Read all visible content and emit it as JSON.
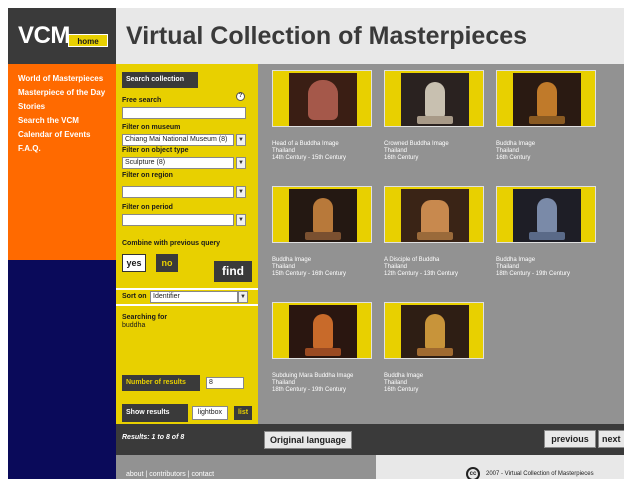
{
  "header": {
    "logo": "VCM",
    "home_label": "home",
    "title": "Virtual Collection of Masterpieces"
  },
  "nav": {
    "items": [
      {
        "label": "World of Masterpieces"
      },
      {
        "label": "Masterpiece of the Day"
      },
      {
        "label": "Stories"
      },
      {
        "label": "Search the VCM"
      },
      {
        "label": "Calendar of Events"
      },
      {
        "label": "F.A.Q."
      }
    ]
  },
  "search": {
    "tab_label": "Search collection",
    "free_search_label": "Free search",
    "free_search_value": "",
    "help_icon": "?",
    "museum_label": "Filter on museum",
    "museum_value": "Chiang Mai National Museum (8)",
    "object_type_label": "Filter on object type",
    "object_type_value": "Sculpture (8)",
    "region_label": "Filter on region",
    "region_value": "",
    "period_label": "Filter on period",
    "period_value": "",
    "combine_label": "Combine with previous query",
    "yes_label": "yes",
    "no_label": "no",
    "find_label": "find",
    "sort_label": "Sort on",
    "sort_value": "Identifier",
    "searching_for_label": "Searching for",
    "searching_for_value": "buddha",
    "num_results_label": "Number of results",
    "num_results_value": "8",
    "show_results_label": "Show results",
    "lightbox_label": "lightbox",
    "list_label": "list",
    "results_count": "Results: 1 to 8 of 8"
  },
  "results": [
    {
      "name": "Head of a Buddha Image",
      "country": "Thailand",
      "period": "14th Century - 15th Century"
    },
    {
      "name": "Crowned Buddha Image",
      "country": "Thailand",
      "period": "16th Century"
    },
    {
      "name": "Buddha Image",
      "country": "Thailand",
      "period": "16th Century"
    },
    {
      "name": "Buddha Image",
      "country": "Thailand",
      "period": "15th Century - 16th Century"
    },
    {
      "name": "A Disciple of Buddha",
      "country": "Thailand",
      "period": "12th Century - 13th Century"
    },
    {
      "name": "Buddha Image",
      "country": "Thailand",
      "period": "18th Century - 19th Century"
    },
    {
      "name": "Subduing Mara Buddha Image",
      "country": "Thailand",
      "period": "18th Century - 19th Century"
    },
    {
      "name": "Buddha Image",
      "country": "Thailand",
      "period": "16th Century"
    }
  ],
  "pager": {
    "original_language": "Original language",
    "previous": "previous",
    "next": "next"
  },
  "footer": {
    "links": "about  |  contributors  |  contact",
    "cc_icon": "cc",
    "copyright": "2007 - Virtual Collection of Masterpieces"
  },
  "colors": {
    "orange": "#ff6a00",
    "yellow": "#e8d000",
    "dark": "#3a3a3a",
    "navy": "#0a0a5a",
    "grey": "#929292"
  }
}
